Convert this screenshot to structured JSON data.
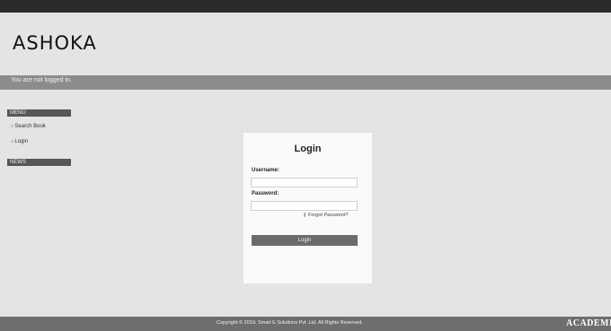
{
  "header": {
    "logo_text": "ASHOKA"
  },
  "status_bar": {
    "text": "You are not logged in."
  },
  "sidebar": {
    "sections": [
      {
        "title": "MENU",
        "items": [
          {
            "label": "Search Book"
          },
          {
            "label": "Login"
          }
        ]
      },
      {
        "title": "NEWS"
      }
    ]
  },
  "login": {
    "title": "Login",
    "username_label": "Username:",
    "username_value": "",
    "password_label": "Password:",
    "password_value": "",
    "forgot_label": "Forgot Password?",
    "submit_label": "Login"
  },
  "footer": {
    "copyright": "Copyright © 2019. Smart E Solutions Pvt. Ltd. All Rights Reserved.",
    "brand": "ACADEMIA"
  },
  "colors": {
    "top_bar": "#2b2b2b",
    "status_bar": "#8c8c8c",
    "sidebar_header": "#575757",
    "button": "#6b6b6b",
    "footer": "#6e6e6e",
    "page_background": "#e4e4e4"
  }
}
